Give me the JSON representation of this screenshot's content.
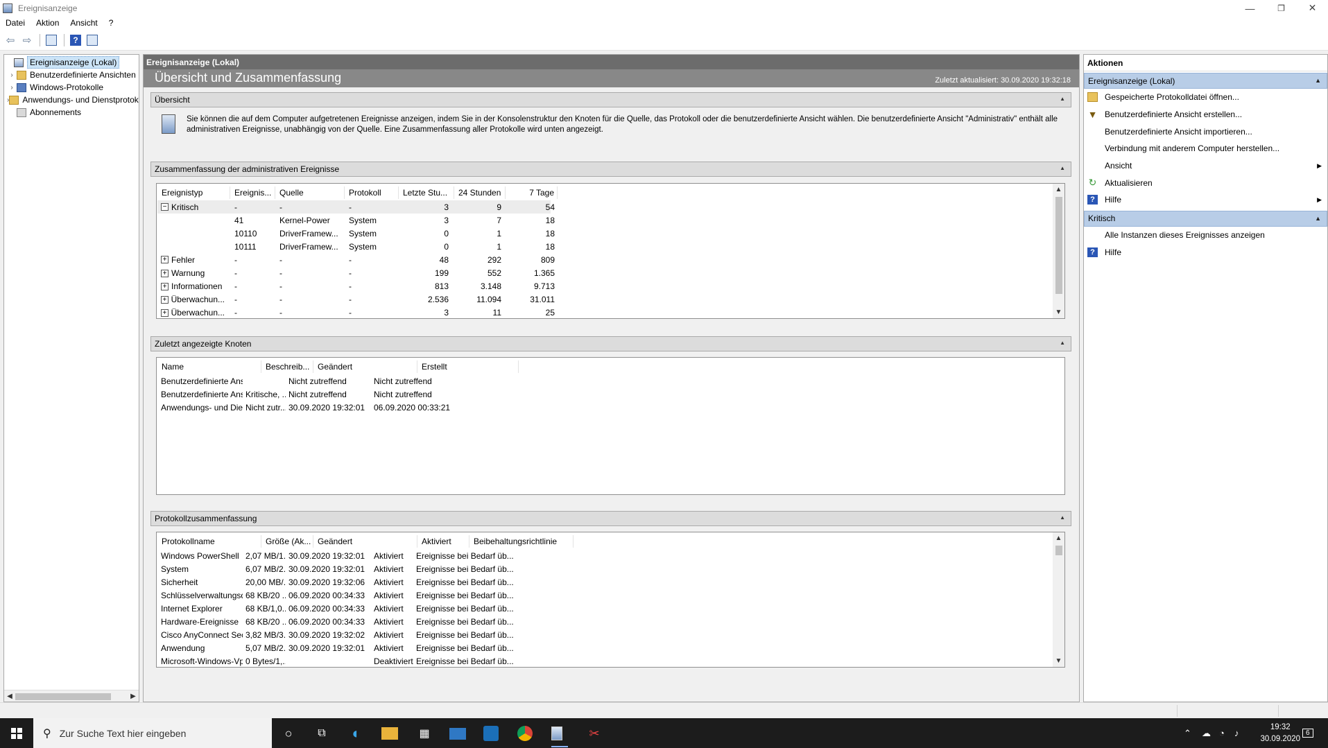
{
  "window": {
    "title": "Ereignisanzeige",
    "min": "—",
    "restore": "❐",
    "close": "✕"
  },
  "menu": [
    "Datei",
    "Aktion",
    "Ansicht",
    "?"
  ],
  "toolbar": {
    "back": "⇦",
    "forward": "⇨"
  },
  "tree": [
    {
      "label": "Ereignisanzeige (Lokal)",
      "icon": "event-viewer-icon",
      "expander": ""
    },
    {
      "label": "Benutzerdefinierte Ansichten",
      "icon": "folder-icon",
      "expander": "›"
    },
    {
      "label": "Windows-Protokolle",
      "icon": "logs-icon",
      "expander": "›"
    },
    {
      "label": "Anwendungs- und Dienstprotokolle",
      "icon": "folder-icon",
      "expander": "›"
    },
    {
      "label": "Abonnements",
      "icon": "subscriptions-icon",
      "expander": ""
    }
  ],
  "center": {
    "header": "Ereignisanzeige (Lokal)",
    "subtitle": "Übersicht und Zusammenfassung",
    "updated": "Zuletzt aktualisiert: 30.09.2020 19:32:18",
    "overview": {
      "title": "Übersicht",
      "text": "Sie können die auf dem Computer aufgetretenen Ereignisse anzeigen, indem Sie in der Konsolenstruktur den Knoten für die Quelle, das Protokoll oder die benutzerdefinierte Ansicht wählen. Die benutzerdefinierte Ansicht \"Administrativ\" enthält alle administrativen Ereignisse, unabhängig von der Quelle. Eine Zusammenfassung aller Protokolle wird unten angezeigt."
    },
    "summary": {
      "title": "Zusammenfassung der administrativen Ereignisse",
      "columns": [
        "Ereignistyp",
        "Ereignis...",
        "Quelle",
        "Protokoll",
        "Letzte Stu...",
        "24 Stunden",
        "7 Tage"
      ],
      "rows": [
        {
          "toggle": "−",
          "type": "Kritisch",
          "id": "-",
          "source": "-",
          "log": "-",
          "h1": "3",
          "h24": "9",
          "d7": "54"
        },
        {
          "toggle": "",
          "type": "",
          "id": "41",
          "source": "Kernel-Power",
          "log": "System",
          "h1": "3",
          "h24": "7",
          "d7": "18"
        },
        {
          "toggle": "",
          "type": "",
          "id": "10110",
          "source": "DriverFramew...",
          "log": "System",
          "h1": "0",
          "h24": "1",
          "d7": "18"
        },
        {
          "toggle": "",
          "type": "",
          "id": "10111",
          "source": "DriverFramew...",
          "log": "System",
          "h1": "0",
          "h24": "1",
          "d7": "18"
        },
        {
          "toggle": "+",
          "type": "Fehler",
          "id": "-",
          "source": "-",
          "log": "-",
          "h1": "48",
          "h24": "292",
          "d7": "809"
        },
        {
          "toggle": "+",
          "type": "Warnung",
          "id": "-",
          "source": "-",
          "log": "-",
          "h1": "199",
          "h24": "552",
          "d7": "1.365"
        },
        {
          "toggle": "+",
          "type": "Informationen",
          "id": "-",
          "source": "-",
          "log": "-",
          "h1": "813",
          "h24": "3.148",
          "d7": "9.713"
        },
        {
          "toggle": "+",
          "type": "Überwachun...",
          "id": "-",
          "source": "-",
          "log": "-",
          "h1": "2.536",
          "h24": "11.094",
          "d7": "31.011"
        },
        {
          "toggle": "+",
          "type": "Überwachun...",
          "id": "-",
          "source": "-",
          "log": "-",
          "h1": "3",
          "h24": "11",
          "d7": "25"
        }
      ]
    },
    "recent": {
      "title": "Zuletzt angezeigte Knoten",
      "columns": [
        "Name",
        "Beschreib...",
        "Geändert",
        "Erstellt"
      ],
      "rows": [
        [
          "Benutzerdefinierte Ansic...",
          "",
          "Nicht zutreffend",
          "Nicht zutreffend"
        ],
        [
          "Benutzerdefinierte Ansic...",
          "Kritische, ...",
          "Nicht zutreffend",
          "Nicht zutreffend"
        ],
        [
          "Anwendungs- und Diens...",
          "Nicht zutr...",
          "30.09.2020 19:32:01",
          "06.09.2020 00:33:21"
        ]
      ]
    },
    "logs": {
      "title": "Protokollzusammenfassung",
      "columns": [
        "Protokollname",
        "Größe (Ak...",
        "Geändert",
        "Aktiviert",
        "Beibehaltungsrichtlinie"
      ],
      "rows": [
        [
          "Windows PowerShell",
          "2,07 MB/1...",
          "30.09.2020 19:32:01",
          "Aktiviert",
          "Ereignisse bei Bedarf üb..."
        ],
        [
          "System",
          "6,07 MB/2...",
          "30.09.2020 19:32:01",
          "Aktiviert",
          "Ereignisse bei Bedarf üb..."
        ],
        [
          "Sicherheit",
          "20,00 MB/...",
          "30.09.2020 19:32:06",
          "Aktiviert",
          "Ereignisse bei Bedarf üb..."
        ],
        [
          "Schlüsselverwaltungsdie...",
          "68 KB/20 ...",
          "06.09.2020 00:34:33",
          "Aktiviert",
          "Ereignisse bei Bedarf üb..."
        ],
        [
          "Internet Explorer",
          "68 KB/1,0...",
          "06.09.2020 00:34:33",
          "Aktiviert",
          "Ereignisse bei Bedarf üb..."
        ],
        [
          "Hardware-Ereignisse",
          "68 KB/20 ...",
          "06.09.2020 00:34:33",
          "Aktiviert",
          "Ereignisse bei Bedarf üb..."
        ],
        [
          "Cisco AnyConnect Secur...",
          "3,82 MB/3...",
          "30.09.2020 19:32:02",
          "Aktiviert",
          "Ereignisse bei Bedarf üb..."
        ],
        [
          "Anwendung",
          "5,07 MB/2...",
          "30.09.2020 19:32:01",
          "Aktiviert",
          "Ereignisse bei Bedarf üb..."
        ],
        [
          "Microsoft-Windows-Vpn...",
          "0 Bytes/1,...",
          "",
          "Deaktiviert",
          "Ereignisse bei Bedarf üb..."
        ]
      ]
    }
  },
  "actions": {
    "title": "Aktionen",
    "sections": [
      {
        "title": "Ereignisanzeige (Lokal)",
        "items": [
          {
            "label": "Gespeicherte Protokolldatei öffnen...",
            "icon": "open-log-icon",
            "submenu": false
          },
          {
            "label": "Benutzerdefinierte Ansicht erstellen...",
            "icon": "filter-icon",
            "submenu": false
          },
          {
            "label": "Benutzerdefinierte Ansicht importieren...",
            "icon": "",
            "submenu": false
          },
          {
            "label": "Verbindung mit anderem Computer herstellen...",
            "icon": "",
            "submenu": false
          },
          {
            "label": "Ansicht",
            "icon": "",
            "submenu": true
          },
          {
            "label": "Aktualisieren",
            "icon": "refresh-icon",
            "submenu": false
          },
          {
            "label": "Hilfe",
            "icon": "help-icon",
            "submenu": true
          }
        ]
      },
      {
        "title": "Kritisch",
        "items": [
          {
            "label": "Alle Instanzen dieses Ereignisses anzeigen",
            "icon": "",
            "submenu": false
          },
          {
            "label": "Hilfe",
            "icon": "help-icon",
            "submenu": false
          }
        ]
      }
    ]
  },
  "taskbar": {
    "search_placeholder": "Zur Suche Text hier eingeben",
    "time": "19:32",
    "date": "30.09.2020",
    "notifications": "6"
  },
  "colors": {
    "accent_selected": "#cce4f7",
    "section_blue": "#b8cde7",
    "header_gray": "#6c6c6c",
    "taskbar": "#1c1c1c"
  }
}
